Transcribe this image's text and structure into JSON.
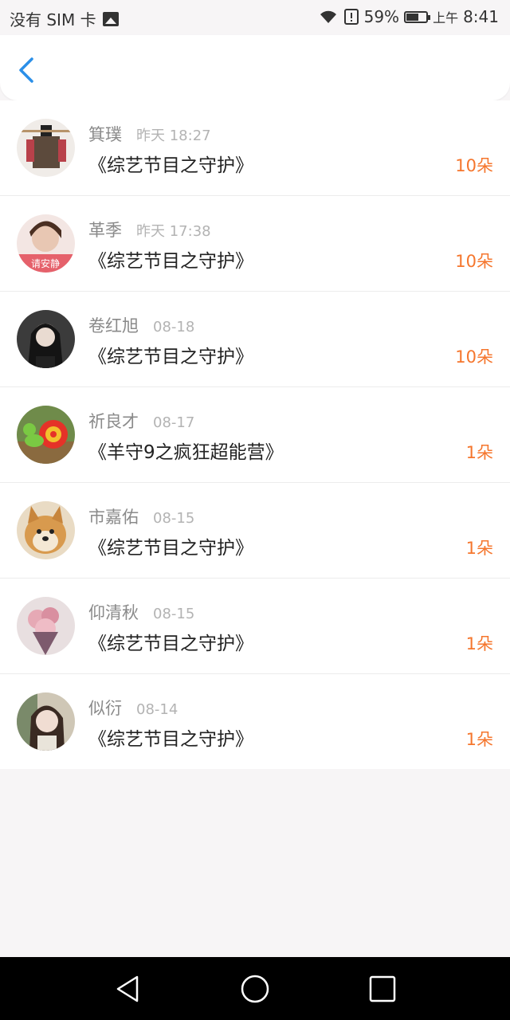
{
  "status_bar": {
    "carrier": "没有 SIM 卡",
    "battery_percent": "59%",
    "battery_level": 0.59,
    "ampm": "上午",
    "time": "8:41"
  },
  "colors": {
    "accent_blue": "#2b8fe8",
    "count_orange": "#f5762d"
  },
  "items": [
    {
      "name": "箕璞",
      "time": "昨天 18:27",
      "title": "《综艺节目之守护》",
      "count": "10朵",
      "avatar": "fashion-figure"
    },
    {
      "name": "革季",
      "time": "昨天 17:38",
      "title": "《综艺节目之守护》",
      "count": "10朵",
      "avatar": "girl-pink-banner"
    },
    {
      "name": "卷红旭",
      "time": "08-18",
      "title": "《综艺节目之守护》",
      "count": "10朵",
      "avatar": "woman-dark"
    },
    {
      "name": "祈良才",
      "time": "08-17",
      "title": "《羊守9之疯狂超能营》",
      "count": "1朵",
      "avatar": "snail-toy"
    },
    {
      "name": "市嘉佑",
      "time": "08-15",
      "title": "《综艺节目之守护》",
      "count": "1朵",
      "avatar": "shiba-dog"
    },
    {
      "name": "仰清秋",
      "time": "08-15",
      "title": "《综艺节目之守护》",
      "count": "1朵",
      "avatar": "flower-bouquet"
    },
    {
      "name": "似衍",
      "time": "08-14",
      "title": "《综艺节目之守护》",
      "count": "1朵",
      "avatar": "girl-portrait"
    }
  ]
}
